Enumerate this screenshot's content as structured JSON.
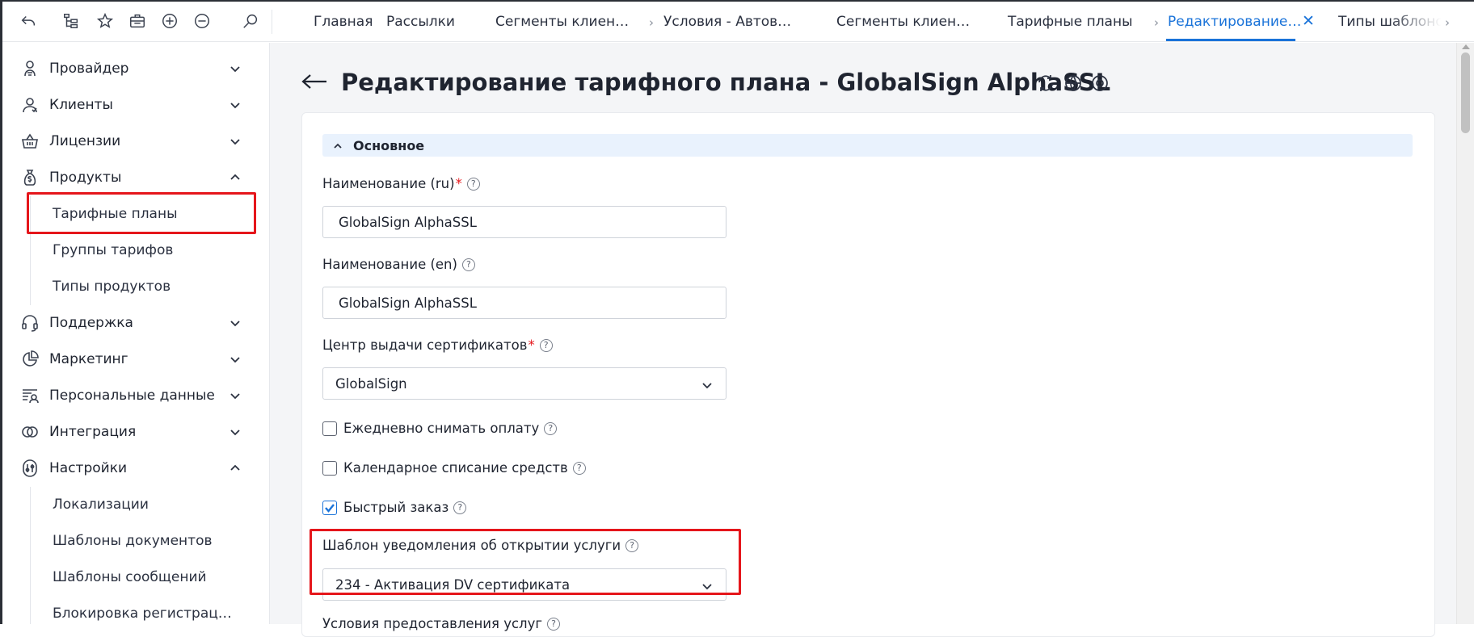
{
  "topbar": {
    "icons": [
      "back-icon",
      "tree-icon",
      "star-icon",
      "briefcase-icon",
      "plus-circle-icon",
      "minus-circle-icon",
      "search-icon"
    ],
    "tabs": [
      {
        "label": "Главная"
      },
      {
        "label": "Рассылки"
      },
      {
        "label": "Сегменты клиен…"
      },
      {
        "label": "Условия - Автов…"
      },
      {
        "label": "Сегменты клиен…"
      },
      {
        "label": "Тарифные планы"
      },
      {
        "label": "Редактирование…",
        "active": true
      },
      {
        "label": "Типы шаблонов"
      }
    ],
    "close_glyph": "✕",
    "chevron_glyph": "›"
  },
  "sidebar": {
    "items": [
      {
        "label": "Провайдер",
        "icon": "provider-icon",
        "expanded": false
      },
      {
        "label": "Клиенты",
        "icon": "clients-icon",
        "expanded": false
      },
      {
        "label": "Лицензии",
        "icon": "basket-icon",
        "expanded": false
      },
      {
        "label": "Продукты",
        "icon": "money-bag-icon",
        "expanded": true
      },
      {
        "label": "Поддержка",
        "icon": "headset-icon",
        "expanded": false
      },
      {
        "label": "Маркетинг",
        "icon": "pie-chart-icon",
        "expanded": false
      },
      {
        "label": "Персональные данные",
        "icon": "personal-data-icon",
        "expanded": false
      },
      {
        "label": "Интеграция",
        "icon": "integration-icon",
        "expanded": false
      },
      {
        "label": "Настройки",
        "icon": "settings-icon",
        "expanded": true
      }
    ],
    "products_sub": [
      "Тарифные планы",
      "Группы тарифов",
      "Типы продуктов"
    ],
    "settings_sub": [
      "Локализации",
      "Шаблоны документов",
      "Шаблоны сообщений",
      "Блокировка регистрац…"
    ]
  },
  "page": {
    "title": "Редактирование тарифного плана - GlobalSign AlphaSSL",
    "section": "Основное",
    "help_glyph": "?",
    "fields": {
      "name_ru_label": "Наименование (ru)",
      "name_ru_value": "GlobalSign AlphaSSL",
      "name_en_label": "Наименование (en)",
      "name_en_value": "GlobalSign AlphaSSL",
      "ca_label": "Центр выдачи сертификатов",
      "ca_value": "GlobalSign",
      "daily_charge_label": "Ежедневно снимать оплату",
      "daily_charge_checked": false,
      "calendar_charge_label": "Календарное списание средств",
      "calendar_charge_checked": false,
      "quick_order_label": "Быстрый заказ",
      "quick_order_checked": true,
      "template_label": "Шаблон уведомления об открытии услуги",
      "template_value": "234 - Активация DV сертификата",
      "conditions_label": "Условия предоставления услуг"
    },
    "required_mark": "*"
  },
  "colors": {
    "accent": "#1a73d9",
    "highlight": "#e5161b",
    "section_bg": "#e9f2fd",
    "main_bg": "#f4f5f7"
  }
}
